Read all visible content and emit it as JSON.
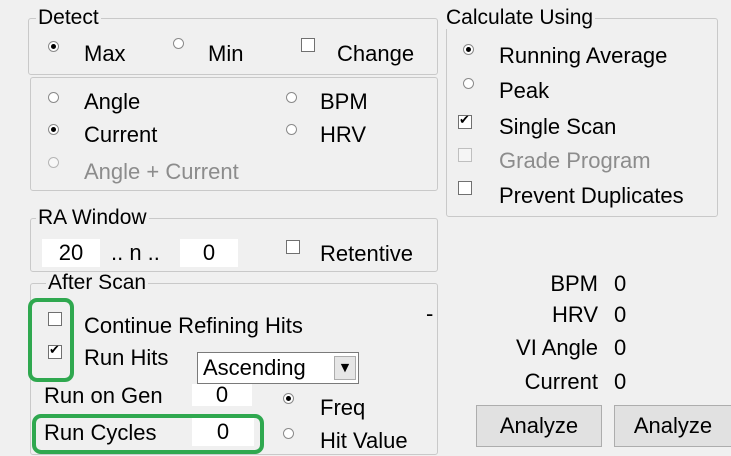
{
  "detect": {
    "title": "Detect",
    "max_label": "Max",
    "min_label": "Min",
    "change_label": "Change",
    "mode": "Max",
    "change_checked": false,
    "options": [
      "Angle",
      "Current",
      "Angle + Current",
      "BPM",
      "HRV"
    ],
    "selected_option": "Current"
  },
  "calculate": {
    "title": "Calculate Using",
    "running_average": "Running Average",
    "peak": "Peak",
    "single_scan": "Single Scan",
    "grade_program": "Grade Program",
    "prevent_duplicates": "Prevent Duplicates",
    "selected": "Running Average",
    "single_scan_checked": true,
    "grade_program_checked": false,
    "prevent_duplicates_checked": false
  },
  "ra_window": {
    "title": "RA Window",
    "from_value": "20",
    "range_text": ".. n ..",
    "to_value": "0",
    "retentive_label": "Retentive",
    "retentive_checked": false
  },
  "after_scan": {
    "title": "After Scan",
    "continue_refining_label": "Continue Refining Hits",
    "continue_refining_checked": false,
    "dash": "-",
    "run_hits_label": "Run Hits",
    "run_hits_checked": true,
    "order_value": "Ascending",
    "run_on_gen_label": "Run on Gen",
    "run_on_gen_value": "0",
    "run_cycles_label": "Run Cycles",
    "run_cycles_value": "0",
    "freq_label": "Freq",
    "hit_value_label": "Hit Value",
    "mode": "Freq"
  },
  "readouts": {
    "bpm_label": "BPM",
    "bpm_value": "0",
    "hrv_label": "HRV",
    "hrv_value": "0",
    "vi_angle_label": "VI Angle",
    "vi_angle_value": "0",
    "current_label": "Current",
    "current_value": "0"
  },
  "buttons": {
    "analyze_1": "Analyze",
    "analyze_2": "Analyze"
  },
  "colors": {
    "highlight": "#2fa84f",
    "window_bg": "#f0f0f0",
    "disabled_text": "#8c8c8c"
  }
}
